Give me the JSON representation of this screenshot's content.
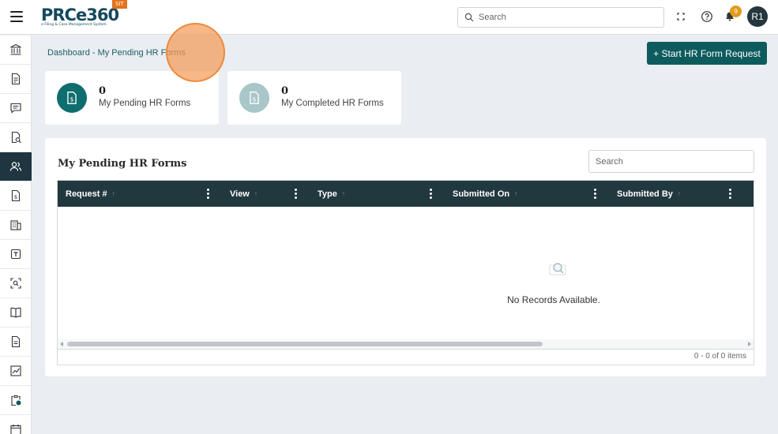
{
  "app": {
    "logo_text": "PRCe360",
    "logo_subtitle": "e-Filing & Case Management System",
    "env_badge": "SIT"
  },
  "header": {
    "search_placeholder": "Search",
    "notification_count": "9",
    "avatar_initials": "R1"
  },
  "sidebar": {
    "items": [
      {
        "icon": "bank-icon",
        "active": false
      },
      {
        "icon": "document-icon",
        "active": false
      },
      {
        "icon": "message-icon",
        "active": false
      },
      {
        "icon": "document-search-icon",
        "active": false
      },
      {
        "icon": "users-icon",
        "active": true
      },
      {
        "icon": "dollar-document-icon",
        "active": false
      },
      {
        "icon": "building-icon",
        "active": false
      },
      {
        "icon": "template-icon",
        "active": false
      },
      {
        "icon": "scan-icon",
        "active": false
      },
      {
        "icon": "book-icon",
        "active": false
      },
      {
        "icon": "file-icon",
        "active": false
      },
      {
        "icon": "chart-icon",
        "active": false
      },
      {
        "icon": "clipboard-clock-icon",
        "active": false
      },
      {
        "icon": "calendar-icon",
        "active": false
      }
    ]
  },
  "breadcrumb": "Dashboard - My Pending HR Forms",
  "actions": {
    "start_button": "+ Start HR Form Request"
  },
  "stats": [
    {
      "count": "0",
      "label": "My Pending HR Forms",
      "color": "#0e6e6d"
    },
    {
      "count": "0",
      "label": "My Completed HR Forms",
      "color": "#a9c6c8"
    }
  ],
  "panel": {
    "title": "My Pending HR Forms",
    "search_placeholder": "Search",
    "columns": [
      "Request #",
      "View",
      "Type",
      "Submitted On",
      "Submitted By"
    ],
    "empty_text": "No Records Available.",
    "pager_text": "0 - 0 of 0 items"
  },
  "colors": {
    "accent": "#0e5b5e",
    "sidebar_active": "#1f3640",
    "grid_header": "#22383f",
    "badge": "#e39a1a"
  }
}
